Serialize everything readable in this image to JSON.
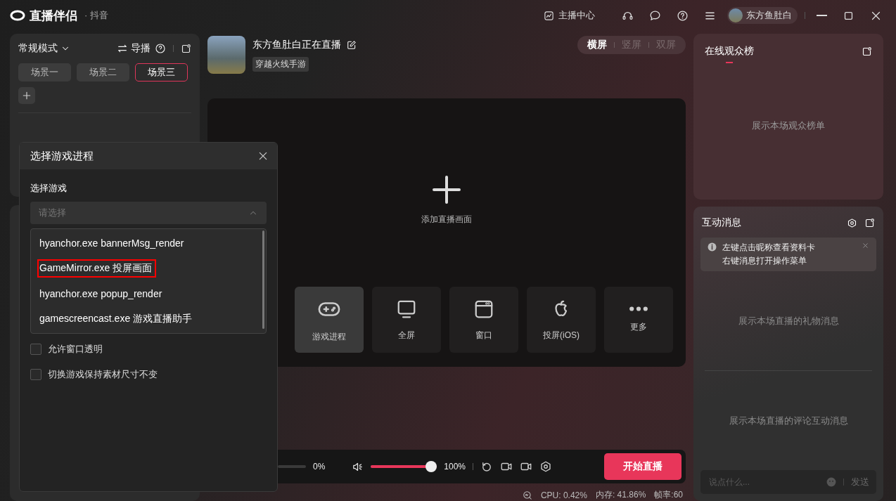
{
  "titlebar": {
    "app_name": "直播伴侣",
    "platform": "· 抖音",
    "creator_center": "主播中心",
    "user_name": "东方鱼肚白"
  },
  "scene_panel": {
    "mode": "常规模式",
    "director": "导播",
    "scenes": [
      {
        "label": "场景一",
        "selected": false
      },
      {
        "label": "场景二",
        "selected": false
      },
      {
        "label": "场景三",
        "selected": true
      }
    ]
  },
  "stream": {
    "title": "东方鱼肚白正在直播",
    "category": "穿越火线手游",
    "orientations": [
      {
        "label": "横屏",
        "selected": true
      },
      {
        "label": "竖屏",
        "selected": false
      },
      {
        "label": "双屏",
        "selected": false
      }
    ]
  },
  "canvas": {
    "add_label": "添加直播画面",
    "sources": [
      {
        "label": "游戏进程",
        "kind": "gamepad",
        "selected": true
      },
      {
        "label": "全屏",
        "kind": "monitor",
        "selected": false
      },
      {
        "label": "窗口",
        "kind": "window",
        "selected": false
      },
      {
        "label": "投屏(iOS)",
        "kind": "apple",
        "selected": false
      },
      {
        "label": "更多",
        "kind": "more",
        "selected": false
      }
    ]
  },
  "controls": {
    "mic": {
      "level": 0,
      "reading": "0%"
    },
    "speaker": {
      "level": 1,
      "reading": "100%"
    },
    "start_button": "开始直播"
  },
  "status_bar": {
    "cpu": "CPU: 0.42%",
    "memory": "内存: 41.86%",
    "fps": "帧率:60"
  },
  "audience_panel": {
    "title": "在线观众榜",
    "empty_text": "展示本场观众榜单"
  },
  "messages_panel": {
    "title": "互动消息",
    "tip_lines": [
      "左键点击昵称查看资料卡",
      "右键消息打开操作菜单"
    ],
    "gift_empty_text": "展示本场直播的礼物消息",
    "comment_empty_text": "展示本场直播的评论互动消息",
    "input": {
      "placeholder": "说点什么..."
    },
    "send_button": "发送"
  },
  "dialog": {
    "title": "选择游戏进程",
    "field_label": "选择游戏",
    "select": {
      "placeholder": "请选择",
      "expanded": true
    },
    "options": [
      {
        "label": "hyanchor.exe bannerMsg_render",
        "highlighted": false
      },
      {
        "label": "GameMirror.exe 投屏画面",
        "highlighted": true
      },
      {
        "label": "hyanchor.exe popup_render",
        "highlighted": false
      },
      {
        "label": "gamescreencast.exe 游戏直播助手",
        "highlighted": false
      }
    ],
    "checkboxes": [
      {
        "label": "允许窗口透明",
        "checked": false
      },
      {
        "label": "切换游戏保持素材尺寸不变",
        "checked": false
      }
    ]
  }
}
